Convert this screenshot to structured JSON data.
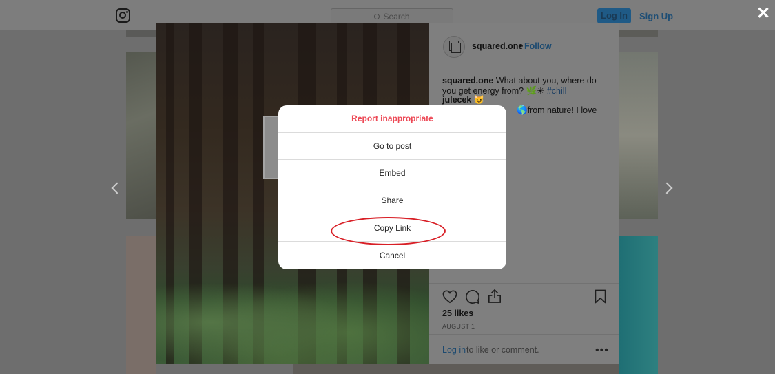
{
  "header": {
    "search_placeholder": "Search",
    "login_label": "Log In",
    "signup_label": "Sign Up",
    "close_glyph": "✕"
  },
  "post": {
    "username": "squared.one",
    "follow_separator": "•",
    "follow_label": "Follow",
    "caption_user": "squared.one",
    "caption_text": "What about you, where do you get energy from? 🌿☀",
    "caption_hashtag": "#chill",
    "comment_user": "julecek",
    "comment_emoji": "😺",
    "comment_text": "🌎from nature! I love",
    "likes": "25 likes",
    "date": "AUGUST 1",
    "login_link": "Log in",
    "login_rest": "to like or comment.",
    "more_glyph": "•••"
  },
  "dialog": {
    "items": [
      {
        "label": "Report inappropriate",
        "kind": "destructive"
      },
      {
        "label": "Go to post",
        "kind": "normal"
      },
      {
        "label": "Embed",
        "kind": "normal"
      },
      {
        "label": "Share",
        "kind": "normal"
      },
      {
        "label": "Copy Link",
        "kind": "normal"
      },
      {
        "label": "Cancel",
        "kind": "normal"
      }
    ],
    "highlighted_item": "Copy Link"
  },
  "colors": {
    "destructive": "#ed4956",
    "link_blue": "#1c4a70",
    "highlight_red": "#d81f26",
    "dialog_bg": "#ffffff"
  },
  "icons": [
    "instagram-logo-icon",
    "search-icon",
    "close-icon",
    "chevron-left-icon",
    "chevron-right-icon",
    "heart-icon",
    "comment-icon",
    "share-icon",
    "bookmark-icon",
    "more-options-icon"
  ]
}
